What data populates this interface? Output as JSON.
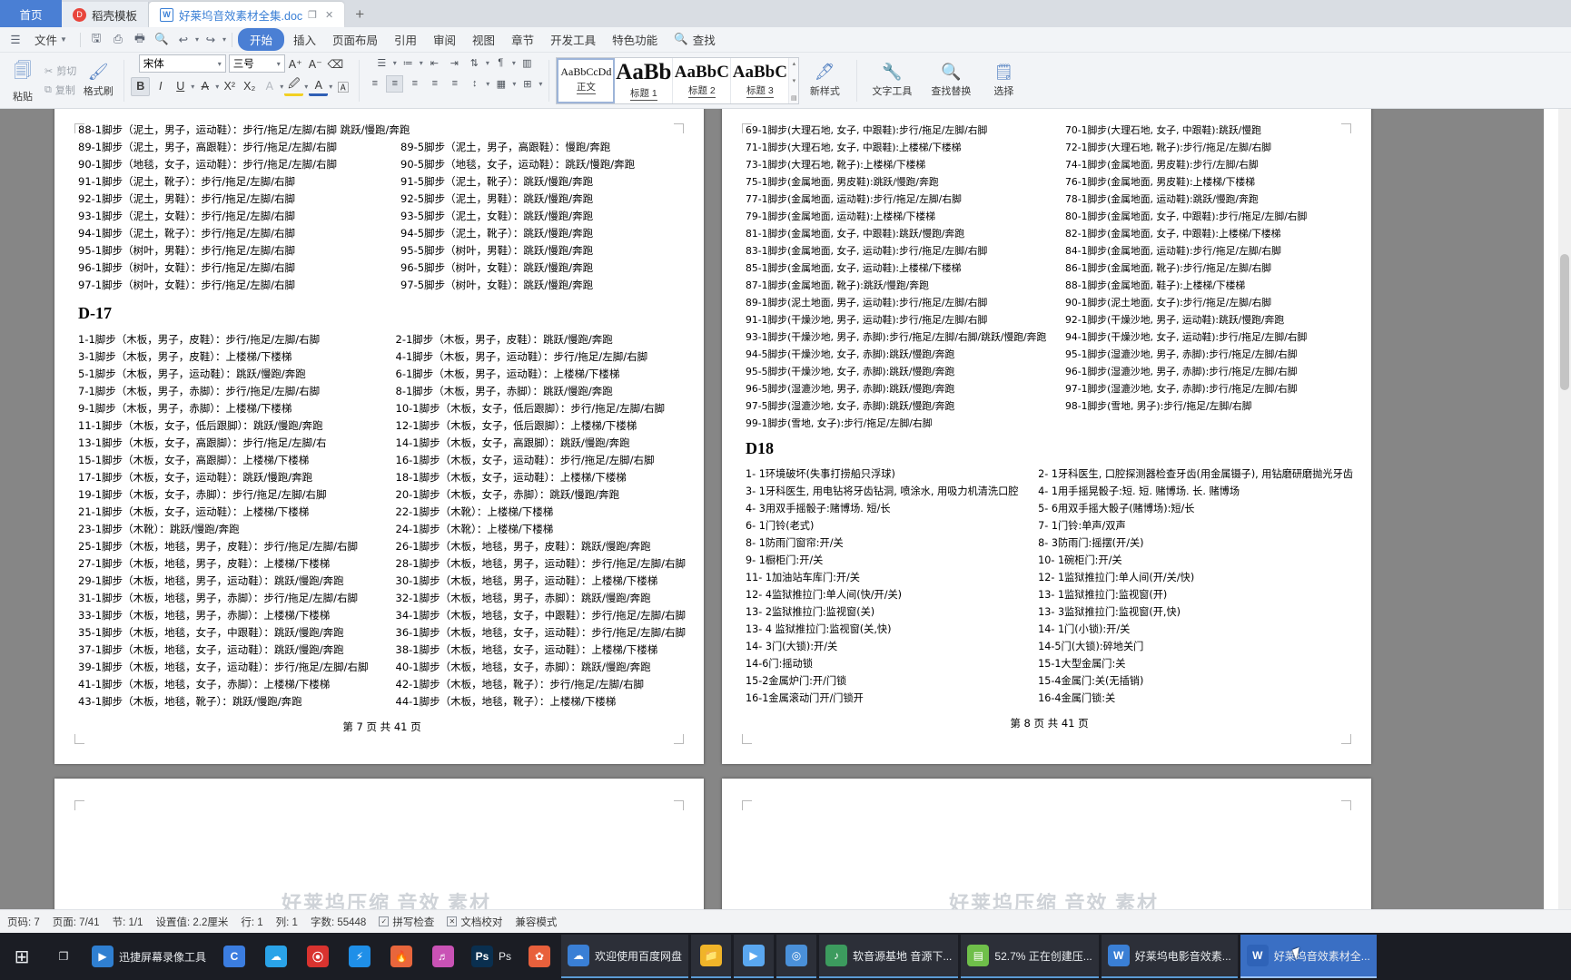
{
  "window": {
    "tabs": [
      {
        "label": "首页",
        "icon": "home-icon",
        "state": "home"
      },
      {
        "label": "稻壳模板",
        "icon": "docer-icon",
        "state": "inactive"
      },
      {
        "label": "好莱坞音效素材全集.doc",
        "icon": "word-doc-icon",
        "state": "active"
      }
    ],
    "tab_controls": {
      "restore": "❐",
      "close": "✕",
      "newtab": "+"
    }
  },
  "menu": {
    "file_label": "文件",
    "quick_access": [
      "save-icon",
      "print-preview-icon",
      "print-icon",
      "find-icon",
      "undo-icon",
      "redo-icon",
      "customize-icon"
    ],
    "items": [
      {
        "label": "开始",
        "selected": true
      },
      {
        "label": "插入",
        "selected": false
      },
      {
        "label": "页面布局",
        "selected": false
      },
      {
        "label": "引用",
        "selected": false
      },
      {
        "label": "审阅",
        "selected": false
      },
      {
        "label": "视图",
        "selected": false
      },
      {
        "label": "章节",
        "selected": false
      },
      {
        "label": "开发工具",
        "selected": false
      },
      {
        "label": "特色功能",
        "selected": false
      }
    ],
    "search_label": "查找"
  },
  "ribbon": {
    "paste_label": "粘贴",
    "cut_label": "剪切",
    "copy_label": "复制",
    "formatpainter_label": "格式刷",
    "font_name": "宋体",
    "font_size": "三号",
    "grow_font": "A⁺",
    "shrink_font": "A⁻",
    "clear_format": "clear-format-icon",
    "bold": "B",
    "italic": "I",
    "underline": "U",
    "strikethrough": "A",
    "superscript": "X²",
    "subscript": "X₂",
    "textbox": "A",
    "highlight": "highlight-icon",
    "fontcolor": "A",
    "pinyin": "A",
    "bullets": "bullets-icon",
    "numbering": "numbering-icon",
    "decrease_indent": "decrease-indent-icon",
    "increase_indent": "increase-indent-icon",
    "sort": "sort-icon",
    "show_marks": "show-marks-icon",
    "align_left": "align-left-icon",
    "align_center": "align-center-icon",
    "align_right": "align-right-icon",
    "justify": "justify-icon",
    "distribute": "distribute-icon",
    "linespacing": "line-spacing-icon",
    "shading": "shading-icon",
    "borders": "borders-icon",
    "styles": [
      {
        "preview": "AaBbCcDd",
        "name": "正文",
        "current": true,
        "size": "12px"
      },
      {
        "preview": "AaBb",
        "name": "标题 1",
        "current": false,
        "size": "24px"
      },
      {
        "preview": "AaBbC",
        "name": "标题 2",
        "current": false,
        "size": "19px"
      },
      {
        "preview": "AaBbC",
        "name": "标题 3",
        "current": false,
        "size": "19px"
      }
    ],
    "newstyle_label": "新样式",
    "texttools_label": "文字工具",
    "findreplace_label": "查找替换",
    "select_label": "选择"
  },
  "document": {
    "page7": {
      "top_lines_full": [
        "88-1脚步（泥土，男子，运动鞋）：步行/拖足/左脚/右脚  跳跃/慢跑/奔跑"
      ],
      "top_left": [
        "89-1脚步（泥土，男子，高跟鞋）：步行/拖足/左脚/右脚",
        "90-1脚步（地毯，女子，运动鞋）：步行/拖足/左脚/右脚",
        "91-1脚步（泥土，靴子）：步行/拖足/左脚/右脚",
        "92-1脚步（泥土，男鞋）：步行/拖足/左脚/右脚",
        "93-1脚步（泥土，女鞋）：步行/拖足/左脚/右脚",
        "94-1脚步（泥土，靴子）：步行/拖足/左脚/右脚",
        "95-1脚步（树叶，男鞋）：步行/拖足/左脚/右脚",
        "96-1脚步（树叶，女鞋）：步行/拖足/左脚/右脚",
        "97-1脚步（树叶，女鞋）：步行/拖足/左脚/右脚"
      ],
      "top_right": [
        "89-5脚步（泥土，男子，高跟鞋）：慢跑/奔跑",
        "90-5脚步（地毯，女子，运动鞋）：跳跃/慢跑/奔跑",
        "91-5脚步（泥土，靴子）：跳跃/慢跑/奔跑",
        "92-5脚步（泥土，男鞋）：跳跃/慢跑/奔跑",
        "93-5脚步（泥土，女鞋）：跳跃/慢跑/奔跑",
        "94-5脚步（泥土，靴子）：跳跃/慢跑/奔跑",
        "95-5脚步（树叶，男鞋）：跳跃/慢跑/奔跑",
        "96-5脚步（树叶，女鞋）：跳跃/慢跑/奔跑",
        "97-5脚步（树叶，女鞋）：跳跃/慢跑/奔跑"
      ],
      "heading": "D-17",
      "body_left": [
        "1-1脚步（木板，男子，皮鞋）：步行/拖足/左脚/右脚",
        "3-1脚步（木板，男子，皮鞋）：上楼梯/下楼梯",
        "5-1脚步（木板，男子，运动鞋）：跳跃/慢跑/奔跑",
        "7-1脚步（木板，男子，赤脚）：步行/拖足/左脚/右脚",
        "9-1脚步（木板，男子，赤脚）：上楼梯/下楼梯",
        "11-1脚步（木板，女子，低后跟脚）：跳跃/慢跑/奔跑",
        "13-1脚步（木板，女子，高跟脚）：步行/拖足/左脚/右",
        "15-1脚步（木板，女子，高跟脚）：上楼梯/下楼梯",
        "17-1脚步（木板，女子，运动鞋）：跳跃/慢跑/奔跑",
        "19-1脚步（木板，女子，赤脚）：步行/拖足/左脚/右脚",
        "21-1脚步（木板，女子，运动鞋）：上楼梯/下楼梯",
        "23-1脚步（木靴）：跳跃/慢跑/奔跑",
        "25-1脚步（木板，地毯，男子，皮鞋）：步行/拖足/左脚/右脚",
        "27-1脚步（木板，地毯，男子，皮鞋）：上楼梯/下楼梯",
        "29-1脚步（木板，地毯，男子，运动鞋）：跳跃/慢跑/奔跑",
        "31-1脚步（木板，地毯，男子，赤脚）：步行/拖足/左脚/右脚",
        "33-1脚步（木板，地毯，男子，赤脚）：上楼梯/下楼梯",
        "35-1脚步（木板，地毯，女子，中跟鞋）：跳跃/慢跑/奔跑",
        "37-1脚步（木板，地毯，女子，运动鞋）：跳跃/慢跑/奔跑",
        "39-1脚步（木板，地毯，女子，运动鞋）：步行/拖足/左脚/右脚",
        "41-1脚步（木板，地毯，女子，赤脚）：上楼梯/下楼梯",
        "43-1脚步（木板，地毯，靴子）：跳跃/慢跑/奔跑"
      ],
      "body_right": [
        "2-1脚步（木板，男子，皮鞋）：跳跃/慢跑/奔跑",
        "4-1脚步（木板，男子，运动鞋）：步行/拖足/左脚/右脚",
        "6-1脚步（木板，男子，运动鞋）：上楼梯/下楼梯",
        "8-1脚步（木板，男子，赤脚）：跳跃/慢跑/奔跑",
        "10-1脚步（木板，女子，低后跟脚）：步行/拖足/左脚/右脚",
        "12-1脚步（木板，女子，低后跟脚）：上楼梯/下楼梯",
        "14-1脚步（木板，女子，高跟脚）：跳跃/慢跑/奔跑",
        "16-1脚步（木板，女子，运动鞋）：步行/拖足/左脚/右脚",
        "18-1脚步（木板，女子，运动鞋）：上楼梯/下楼梯",
        "20-1脚步（木板，女子，赤脚）：跳跃/慢跑/奔跑",
        "22-1脚步（木靴）：上楼梯/下楼梯",
        "24-1脚步（木靴）：上楼梯/下楼梯",
        "26-1脚步（木板，地毯，男子，皮鞋）：跳跃/慢跑/奔跑",
        "28-1脚步（木板，地毯，男子，运动鞋）：步行/拖足/左脚/右脚",
        "30-1脚步（木板，地毯，男子，运动鞋）：上楼梯/下楼梯",
        "32-1脚步（木板，地毯，男子，赤脚）：跳跃/慢跑/奔跑",
        "34-1脚步（木板，地毯，女子，中跟鞋）：步行/拖足/左脚/右脚",
        "36-1脚步（木板，地毯，女子，运动鞋）：步行/拖足/左脚/右脚",
        "38-1脚步（木板，地毯，女子，运动鞋）：上楼梯/下楼梯",
        "40-1脚步（木板，地毯，女子，赤脚）：跳跃/慢跑/奔跑",
        "42-1脚步（木板，地毯，靴子）：步行/拖足/左脚/右脚",
        "44-1脚步（木板，地毯，靴子）：上楼梯/下楼梯"
      ],
      "footer": "第 7 页  共 41 页"
    },
    "page8": {
      "top_left": [
        "69-1脚步(大理石地, 女子, 中跟鞋):步行/拖足/左脚/右脚",
        "71-1脚步(大理石地, 女子, 中跟鞋):上楼梯/下楼梯",
        "73-1脚步(大理石地, 靴子):上楼梯/下楼梯",
        "75-1脚步(金属地面, 男皮鞋):跳跃/慢跑/奔跑",
        "77-1脚步(金属地面, 运动鞋):步行/拖足/左脚/右脚",
        "79-1脚步(金属地面, 运动鞋):上楼梯/下楼梯",
        "81-1脚步(金属地面, 女子, 中跟鞋):跳跃/慢跑/奔跑",
        "83-1脚步(金属地面, 女子, 运动鞋):步行/拖足/左脚/右脚",
        "85-1脚步(金属地面, 女子, 运动鞋):上楼梯/下楼梯",
        "87-1脚步(金属地面, 靴子):跳跃/慢跑/奔跑",
        "89-1脚步(泥土地面, 男子, 运动鞋):步行/拖足/左脚/右脚",
        "91-1脚步(干燥沙地, 男子, 运动鞋):步行/拖足/左脚/右脚",
        "93-1脚步(干燥沙地, 男子, 赤脚):步行/拖足/左脚/右脚/跳跃/慢跑/奔跑",
        "94-5脚步(干燥沙地, 女子, 赤脚):跳跃/慢跑/奔跑",
        "95-5脚步(干燥沙地, 女子, 赤脚):跳跃/慢跑/奔跑",
        "96-5脚步(湿漉沙地, 男子, 赤脚):跳跃/慢跑/奔跑",
        "97-5脚步(湿漉沙地, 女子, 赤脚):跳跃/慢跑/奔跑",
        "99-1脚步(雪地, 女子):步行/拖足/左脚/右脚"
      ],
      "top_right": [
        "70-1脚步(大理石地, 女子, 中跟鞋):跳跃/慢跑",
        "72-1脚步(大理石地, 靴子):步行/拖足/左脚/右脚",
        "74-1脚步(金属地面, 男皮鞋):步行/左脚/右脚",
        "76-1脚步(金属地面, 男皮鞋):上楼梯/下楼梯",
        "78-1脚步(金属地面, 运动鞋):跳跃/慢跑/奔跑",
        "80-1脚步(金属地面, 女子, 中跟鞋):步行/拖足/左脚/右脚",
        "82-1脚步(金属地面, 女子, 中跟鞋):上楼梯/下楼梯",
        "84-1脚步(金属地面, 运动鞋):步行/拖足/左脚/右脚",
        "86-1脚步(金属地面, 靴子):步行/拖足/左脚/右脚",
        "88-1脚步(金属地面, 鞋子):上楼梯/下楼梯",
        "90-1脚步(泥土地面, 女子):步行/拖足/左脚/右脚",
        "92-1脚步(干燥沙地, 男子, 运动鞋):跳跃/慢跑/奔跑",
        "94-1脚步(干燥沙地, 女子, 运动鞋):步行/拖足/左脚/右脚",
        "95-1脚步(湿漉沙地, 男子, 赤脚):步行/拖足/左脚/右脚",
        "96-1脚步(湿漉沙地, 男子, 赤脚):步行/拖足/左脚/右脚",
        "97-1脚步(湿漉沙地, 女子, 赤脚):步行/拖足/左脚/右脚",
        "98-1脚步(雪地, 男子):步行/拖足/左脚/右脚"
      ],
      "heading": "D18",
      "body_left": [
        "1- 1环境破坏(失事打捞船只浮球)",
        "3- 1牙科医生, 用电钻将牙齿钻洞, 喷涂水, 用吸力机清洗口腔",
        "4- 3用双手摇骰子:赌博场. 短/长",
        "6- 1门铃(老式)",
        "8- 1防雨门窗帘:开/关",
        "9- 1橱柜门:开/关",
        "11- 1加油站车库门:开/关",
        "12- 4监狱推拉门:单人间(快/开/关)",
        "13- 2监狱推拉门:监视窗(关)",
        "13- 4 监狱推拉门:监视窗(关,快)",
        "14- 3门(大锁):开/关",
        "14-6门:摇动锁",
        "15-2金属炉门:开/门锁",
        "16-1金属滚动门开/门锁开"
      ],
      "body_right": [
        "2- 1牙科医生, 口腔探测器检查牙齿(用金属镊子), 用钻磨研磨抛光牙齿",
        "4- 1用手摇晃骰子:短. 短. 赌博场. 长. 赌博场",
        "5- 6用双手摇大骰子(赌博场):短/长",
        "7- 1门铃:单声/双声",
        "8- 3防雨门:摇摆(开/关)",
        "10- 1碗柜门:开/关",
        "12- 1监狱推拉门:单人间(开/关/快)",
        "13- 1监狱推拉门:监视窗(开)",
        "13- 3监狱推拉门:监视窗(开,快)",
        "14- 1门(小锁):开/关",
        "14-5门(大锁):碎地关门",
        "15-1大型金属门:关",
        "15-4金属门:关(无插销)",
        "16-4金属门锁:关"
      ],
      "footer": "第 8 页  共 41 页"
    },
    "watermark": "好莱坞压缩 音效 素材"
  },
  "status": {
    "items": [
      {
        "label": "页码: 7"
      },
      {
        "label": "页面: 7/41"
      },
      {
        "label": "节: 1/1"
      },
      {
        "label": "设置值: 2.2厘米"
      },
      {
        "label": "行: 1"
      },
      {
        "label": "列: 1"
      },
      {
        "label": "字数: 55448"
      }
    ],
    "spellcheck_label": "拼写检查",
    "proofread_label": "文档校对",
    "compat_label": "兼容模式"
  },
  "taskbar": {
    "start_icon": "windows-start-icon",
    "taskview_icon": "task-view-icon",
    "pinned": [
      {
        "name": "recorder-app",
        "label": "迅捷屏幕录像工具",
        "glyph": "▶",
        "color": "#2f7fd1"
      },
      {
        "name": "chrome-app",
        "label": "",
        "glyph": "C",
        "color": "#3b7de0"
      },
      {
        "name": "cloud-app",
        "label": "",
        "glyph": "☁",
        "color": "#2aa3e8"
      },
      {
        "name": "wangyi-app",
        "label": "",
        "glyph": "⦿",
        "color": "#d9332f"
      },
      {
        "name": "thunder-app",
        "label": "",
        "glyph": "⚡",
        "color": "#1f8fe8"
      },
      {
        "name": "fire-app",
        "label": "",
        "glyph": "🔥",
        "color": "#e8663c"
      },
      {
        "name": "media-app",
        "label": "",
        "glyph": "♬",
        "color": "#c952b5"
      },
      {
        "name": "photoshop-app",
        "label": "Ps",
        "glyph": "Ps",
        "color": "#0a2f4f"
      },
      {
        "name": "design-app",
        "label": "",
        "glyph": "✿",
        "color": "#e8603c"
      }
    ],
    "windows": [
      {
        "name": "baidu-netdisk",
        "label": "欢迎使用百度网盘",
        "glyph": "☁",
        "color": "#3a7fd5",
        "active": false
      },
      {
        "name": "file-explorer",
        "label": "",
        "glyph": "📁",
        "color": "#f0b429",
        "active": false
      },
      {
        "name": "video-player",
        "label": "",
        "glyph": "▶",
        "color": "#5aa7f0",
        "active": false
      },
      {
        "name": "browser-window",
        "label": "",
        "glyph": "◎",
        "color": "#4a90d9",
        "active": false
      },
      {
        "name": "sound-source-base",
        "label": "软音源基地 音源下...",
        "glyph": "♪",
        "color": "#3c9b5e",
        "active": false
      },
      {
        "name": "compressing-window",
        "label": "52.7% 正在创建压...",
        "glyph": "▤",
        "color": "#6fbf4a",
        "active": false
      },
      {
        "name": "hollywood-movie-sound",
        "label": "好莱坞电影音效素...",
        "glyph": "W",
        "color": "#3a7fd5",
        "active": false
      },
      {
        "name": "hollywood-sound-doc",
        "label": "好莱坞音效素材全...",
        "glyph": "W",
        "color": "#2f63b8",
        "active": true
      }
    ]
  }
}
